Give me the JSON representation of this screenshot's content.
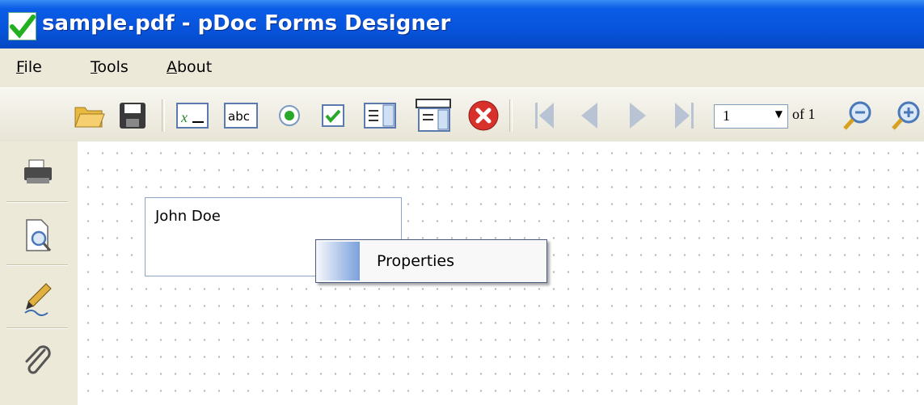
{
  "window": {
    "title": "sample.pdf - pDoc Forms Designer"
  },
  "menu": [
    {
      "label": "File"
    },
    {
      "label": "Tools"
    },
    {
      "label": "About"
    }
  ],
  "toolbar": {
    "icons": [
      "open-folder-icon",
      "save-icon",
      "text-field-icon",
      "label-text-icon",
      "radio-button-icon",
      "checkbox-icon",
      "list-box-icon",
      "combo-box-icon",
      "delete-icon",
      "first-page-icon",
      "previous-page-icon",
      "next-page-icon",
      "last-page-icon",
      "zoom-out-icon",
      "zoom-in-icon"
    ],
    "page_value": "1",
    "page_of": "of 1",
    "abc_label": "abc",
    "x_label": "x"
  },
  "leftbar": {
    "icons": [
      "printer-icon",
      "print-preview-icon",
      "sign-icon",
      "attachment-icon"
    ]
  },
  "canvas": {
    "field_value": "John Doe"
  },
  "context_menu": {
    "items": [
      {
        "label": "Properties"
      }
    ]
  },
  "colors": {
    "titlebar": "#0754dc",
    "chrome": "#ece9d8",
    "accent": "#7aa0dc"
  }
}
